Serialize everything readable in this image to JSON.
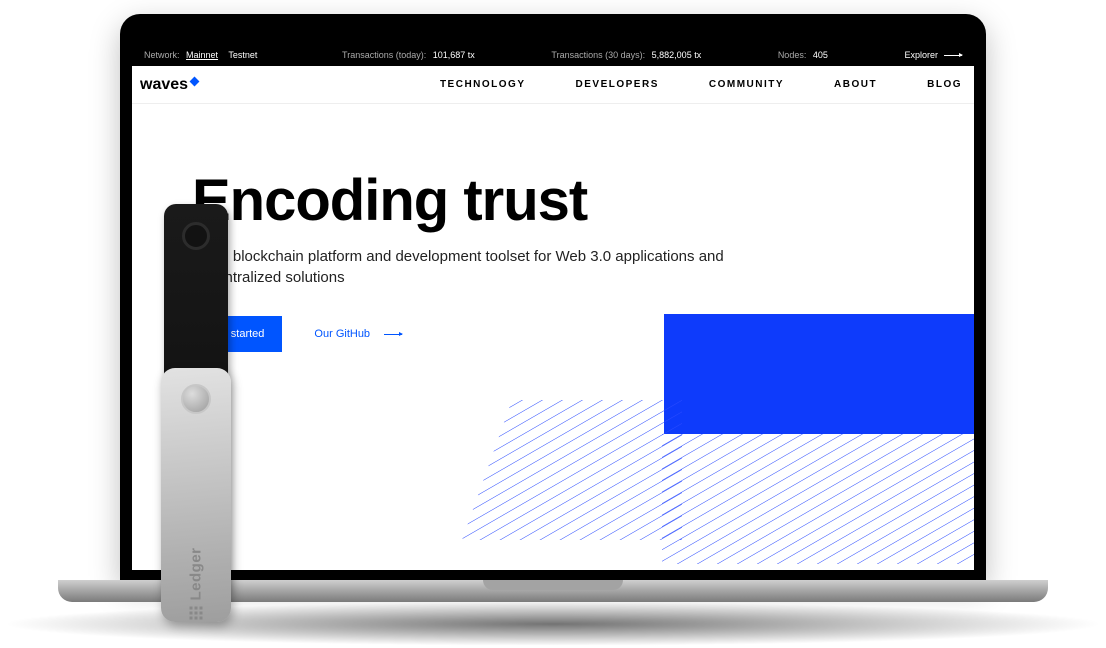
{
  "statbar": {
    "network_label": "Network:",
    "mainnet": "Mainnet",
    "testnet": "Testnet",
    "tx_today_label": "Transactions (today):",
    "tx_today_value": "101,687 tx",
    "tx_30d_label": "Transactions (30 days):",
    "tx_30d_value": "5,882,005 tx",
    "nodes_label": "Nodes:",
    "nodes_value": "405",
    "explorer": "Explorer"
  },
  "nav": {
    "logo": "waves",
    "items": [
      "TECHNOLOGY",
      "DEVELOPERS",
      "COMMUNITY",
      "ABOUT",
      "BLOG"
    ]
  },
  "hero": {
    "title": "Encoding trust",
    "subtitle": "Open blockchain platform and development toolset for Web 3.0 applications and decentralized solutions",
    "cta_primary": "Get started",
    "cta_github": "Our GitHub"
  },
  "device": {
    "brand": "Ledger"
  },
  "colors": {
    "accent": "#0055FF"
  }
}
